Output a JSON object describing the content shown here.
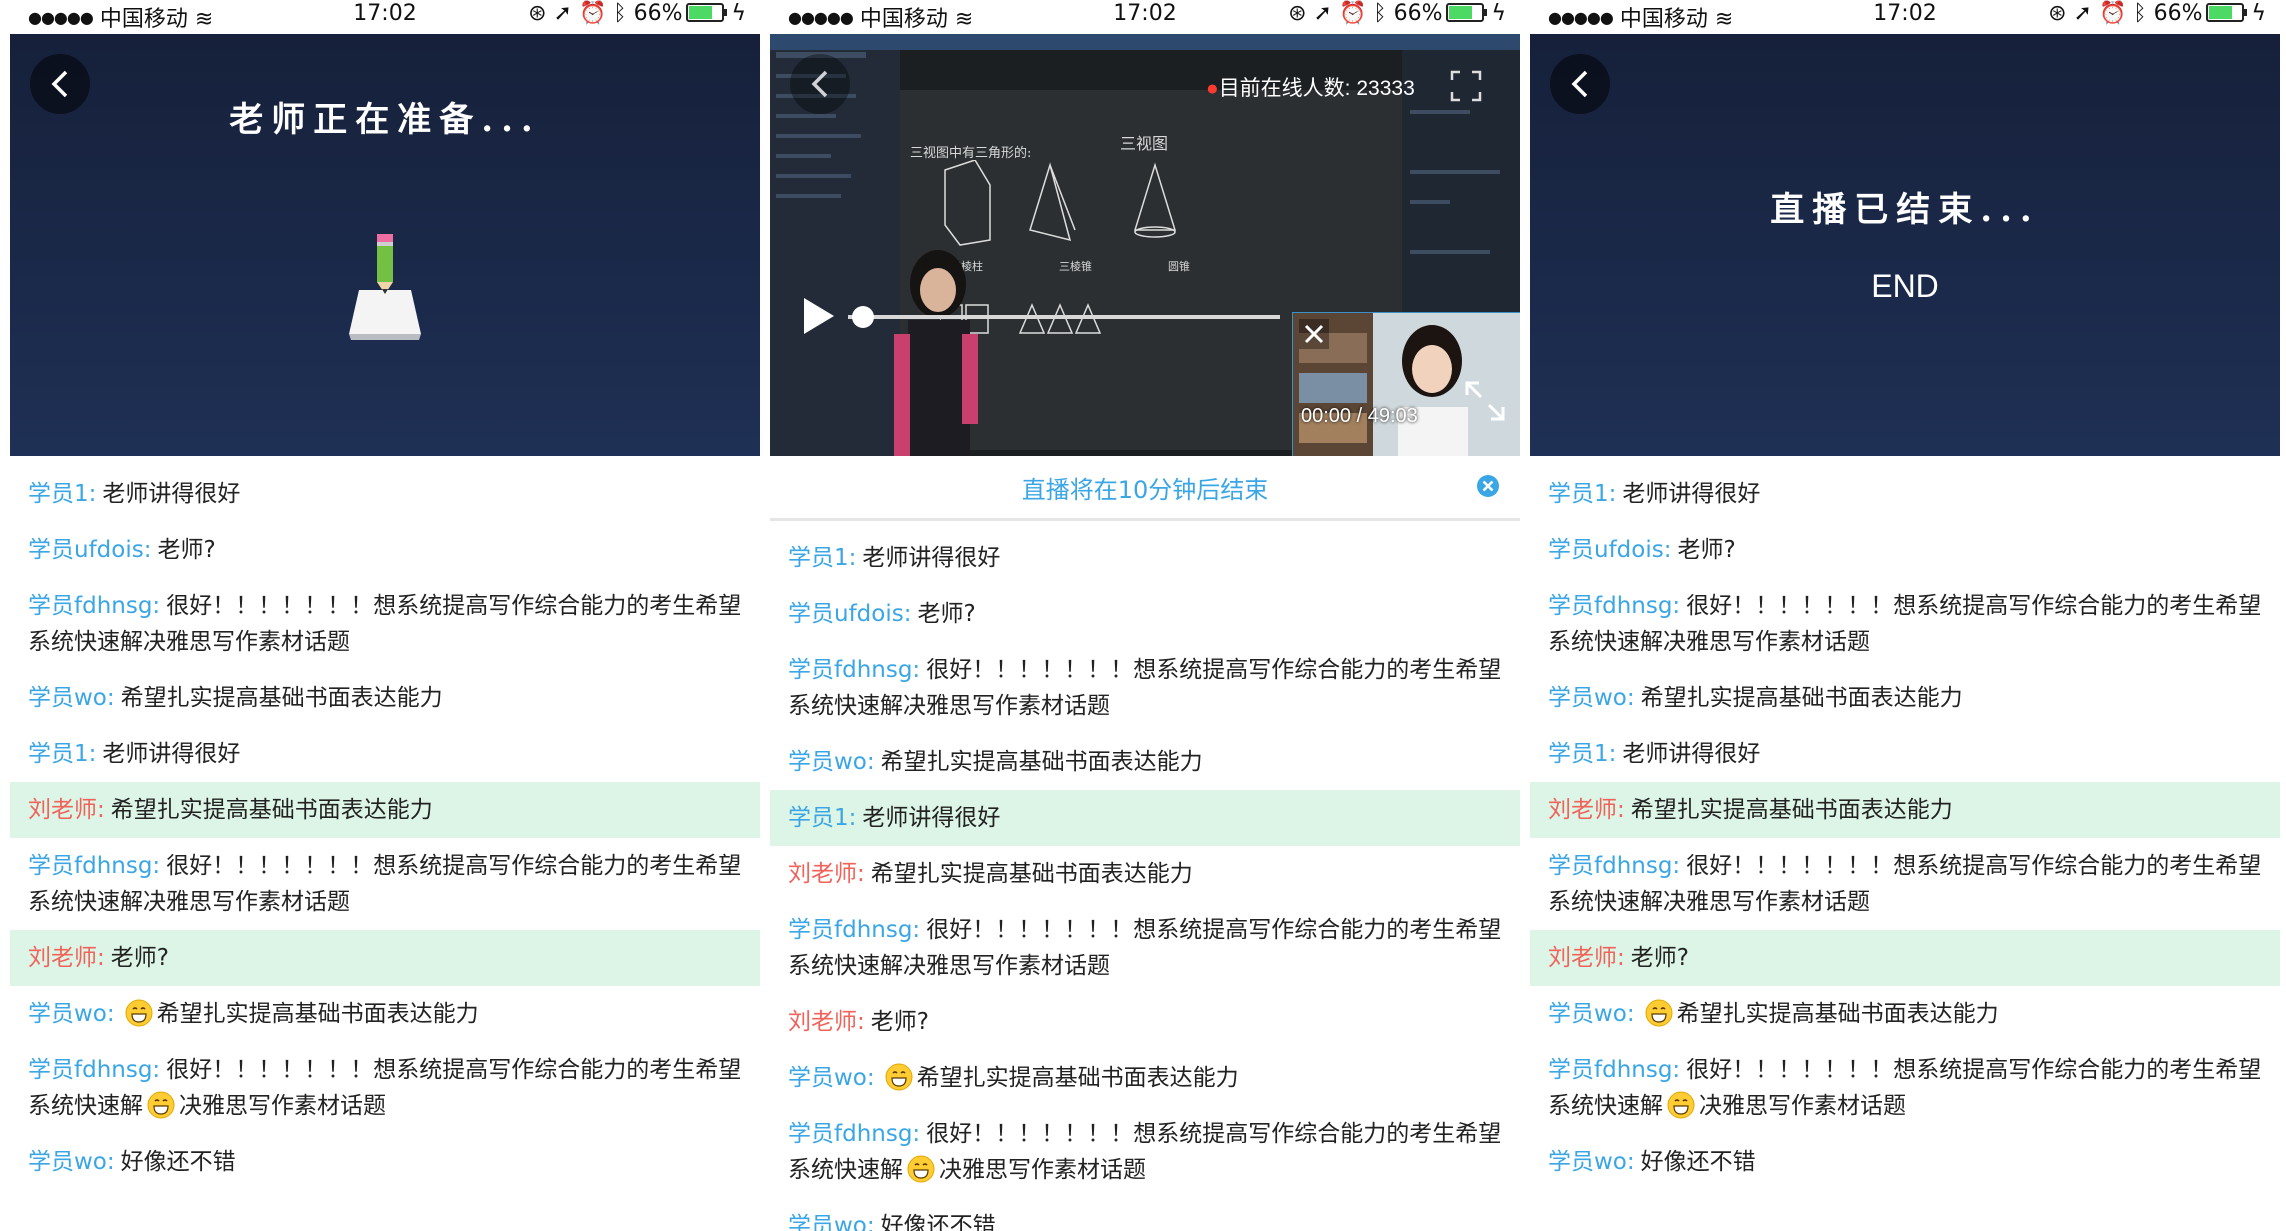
{
  "status_bar": {
    "carrier": "中国移动",
    "time": "17:02",
    "battery_percent": "66%",
    "battery_level": 0.66
  },
  "screen1": {
    "header_text": "老师正在准备..."
  },
  "screen2": {
    "online_label": "目前在线人数:",
    "online_count": "23333",
    "time_display": "00:00 / 49:03",
    "progress": 0.0,
    "notice": "直播将在10分钟后结束",
    "board_title": "三视图",
    "board_note": "三视图中有三角形的:",
    "board_labels": [
      "三棱柱",
      "三棱锥",
      "圆锥"
    ]
  },
  "screen3": {
    "header_text": "直播已结束...",
    "end_text": "END"
  },
  "chat_messages": [
    {
      "name": "学员1:",
      "text": "老师讲得很好",
      "role": "student"
    },
    {
      "name": "学员ufdois:",
      "text": "老师?",
      "role": "student"
    },
    {
      "name": "学员fdhnsg:",
      "text": "很好！！！！！！！想系统提高写作综合能力的考生希望系统快速解决雅思写作素材话题",
      "role": "student"
    },
    {
      "name": "学员wo:",
      "text": "希望扎实提高基础书面表达能力",
      "role": "student"
    },
    {
      "name": "学员1:",
      "text": "老师讲得很好",
      "role": "student"
    },
    {
      "name": "刘老师:",
      "text": "希望扎实提高基础书面表达能力",
      "role": "teacher"
    },
    {
      "name": "学员fdhnsg:",
      "text": "很好！！！！！！！想系统提高写作综合能力的考生希望系统快速解决雅思写作素材话题",
      "role": "student"
    },
    {
      "name": "刘老师:",
      "text": "老师?",
      "role": "teacher"
    },
    {
      "name": "学员wo:",
      "text": "希望扎实提高基础书面表达能力",
      "role": "student",
      "emoji_before": true
    },
    {
      "name": "学员fdhnsg:",
      "text_a": "很好！！！！！！！想系统提高写作综合能力的考生希望系统快速解",
      "text_b": "决雅思写作素材话题",
      "role": "student",
      "emoji_mid": true
    },
    {
      "name": "学员wo:",
      "text": "好像还不错",
      "role": "student"
    }
  ],
  "screen2_chat": [
    {
      "name": "学员1:",
      "text": "老师讲得很好",
      "role": "student"
    },
    {
      "name": "学员ufdois:",
      "text": "老师?",
      "role": "student"
    },
    {
      "name": "学员fdhnsg:",
      "text": "很好！！！！！！！想系统提高写作综合能力的考生希望系统快速解决雅思写作素材话题",
      "role": "student"
    },
    {
      "name": "学员wo:",
      "text": "希望扎实提高基础书面表达能力",
      "role": "student"
    },
    {
      "name": "学员1:",
      "text": "老师讲得很好",
      "role": "student",
      "highlight": true
    },
    {
      "name": "刘老师:",
      "text": "希望扎实提高基础书面表达能力",
      "role": "teacher"
    },
    {
      "name": "学员fdhnsg:",
      "text": "很好！！！！！！！想系统提高写作综合能力的考生希望系统快速解决雅思写作素材话题",
      "role": "student"
    },
    {
      "name": "刘老师:",
      "text": "老师?",
      "role": "teacher"
    },
    {
      "name": "学员wo:",
      "text": "希望扎实提高基础书面表达能力",
      "role": "student",
      "emoji_before": true
    },
    {
      "name": "学员fdhnsg:",
      "text_a": "很好！！！！！！！想系统提高写作综合能力的考生希望系统快速解",
      "text_b": "决雅思写作素材话题",
      "role": "student",
      "emoji_mid": true
    },
    {
      "name": "学员wo:",
      "text": "好像还不错",
      "role": "student"
    }
  ],
  "colors": {
    "student_name": "#3aa6e6",
    "teacher_name": "#f0625a",
    "highlight_bg": "#ddf5e6",
    "video_bg": "#1b2a4a"
  }
}
